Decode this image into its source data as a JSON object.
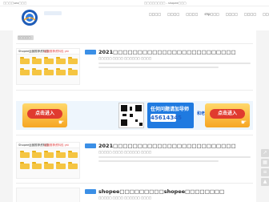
{
  "topbar": {
    "left_text": "□□□□seo□□□",
    "mid_text": "□□□□□□□□ - shopee□□□"
  },
  "header": {
    "logo_icon": "circular-logo-icon",
    "nav": [
      "□□□□",
      "□□□□",
      "□□□□",
      "shp□□□",
      "□□□□",
      "□□□□",
      "□□□□",
      "□□□□"
    ]
  },
  "section": {
    "title": "□□□□□"
  },
  "articles": [
    {
      "banner_left": "Shopee运营推荐资料包",
      "banner_right": "运营推荐资料包 yst",
      "title": "2021□□□□□□□□□□□□□□□□□□□□□□□□□",
      "meta": "□□□□□ □□□□ □□□□□□ □□□□"
    },
    {
      "banner_left": "Shopee运营推荐资料包",
      "banner_right": "运营推荐资料包 yst",
      "title": "2021□□□□□□□□□□□□□□□□□□□□□□□□□",
      "meta": "□□□□□ □□□□ □□□□□□ □□□□"
    },
    {
      "title": "shopee□□□□□□□□□shopee□□□□□□□□",
      "meta": "□□□□□ □□□□ □□□□□□ □□□□"
    }
  ],
  "ad": {
    "left_button": "点击进入",
    "qr_icon": "qr-code-icon",
    "headline": "任何问题请加导师",
    "number": "45614345",
    "tagline": "和老师一对一交流",
    "right_button": "点击进入",
    "cursor_icon": "hand-pointer-icon"
  },
  "side_tools": [
    "share-icon",
    "qr-icon",
    "top-icon",
    "arrow-up-icon"
  ],
  "colors": {
    "accent_blue": "#3b8fe6",
    "ad_orange": "#f6a623",
    "ad_red": "#e03b2f",
    "folder_yellow": "#f5c542"
  }
}
